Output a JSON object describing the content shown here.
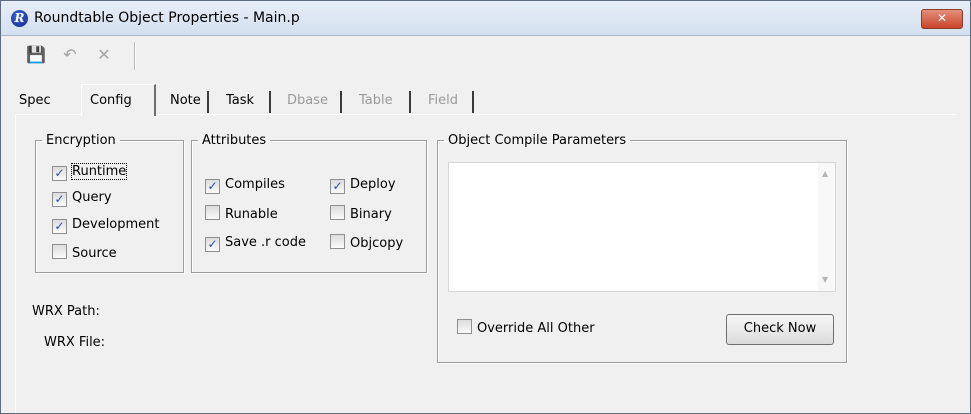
{
  "window": {
    "title": "Roundtable Object Properties - Main.p",
    "app_icon_letter": "R",
    "close_glyph": "✕"
  },
  "toolbar": {
    "buttons": [
      {
        "name": "save-icon",
        "glyph": "💾",
        "enabled": false
      },
      {
        "name": "undo-icon",
        "glyph": "↶",
        "enabled": false
      },
      {
        "name": "delete-icon",
        "glyph": "✕",
        "enabled": false
      }
    ]
  },
  "tabs": [
    {
      "label": "Spec",
      "active": false,
      "enabled": true
    },
    {
      "label": "Config",
      "active": true,
      "enabled": true
    },
    {
      "label": "Note",
      "active": false,
      "enabled": true
    },
    {
      "label": "Task",
      "active": false,
      "enabled": true
    },
    {
      "label": "Dbase",
      "active": false,
      "enabled": false
    },
    {
      "label": "Table",
      "active": false,
      "enabled": false
    },
    {
      "label": "Field",
      "active": false,
      "enabled": false
    }
  ],
  "encryption": {
    "legend": "Encryption",
    "items": [
      {
        "label": "Runtime",
        "checked": true
      },
      {
        "label": "Query",
        "checked": true
      },
      {
        "label": "Development",
        "checked": true
      },
      {
        "label": "Source",
        "checked": false
      }
    ]
  },
  "attributes": {
    "legend": "Attributes",
    "items": [
      {
        "label": "Compiles",
        "checked": true
      },
      {
        "label": "Deploy",
        "checked": true
      },
      {
        "label": "Runable",
        "checked": false
      },
      {
        "label": "Binary",
        "checked": false
      },
      {
        "label": "Save .r code",
        "checked": true
      },
      {
        "label": "Objcopy",
        "checked": false
      }
    ]
  },
  "compile": {
    "legend": "Object Compile Parameters",
    "text_value": "",
    "override_label": "Override All Other",
    "override_checked": false,
    "check_now_label": "Check Now"
  },
  "wrx": {
    "path_label": "WRX Path:",
    "file_label": "WRX File:"
  },
  "checkmark_glyph": "✓"
}
